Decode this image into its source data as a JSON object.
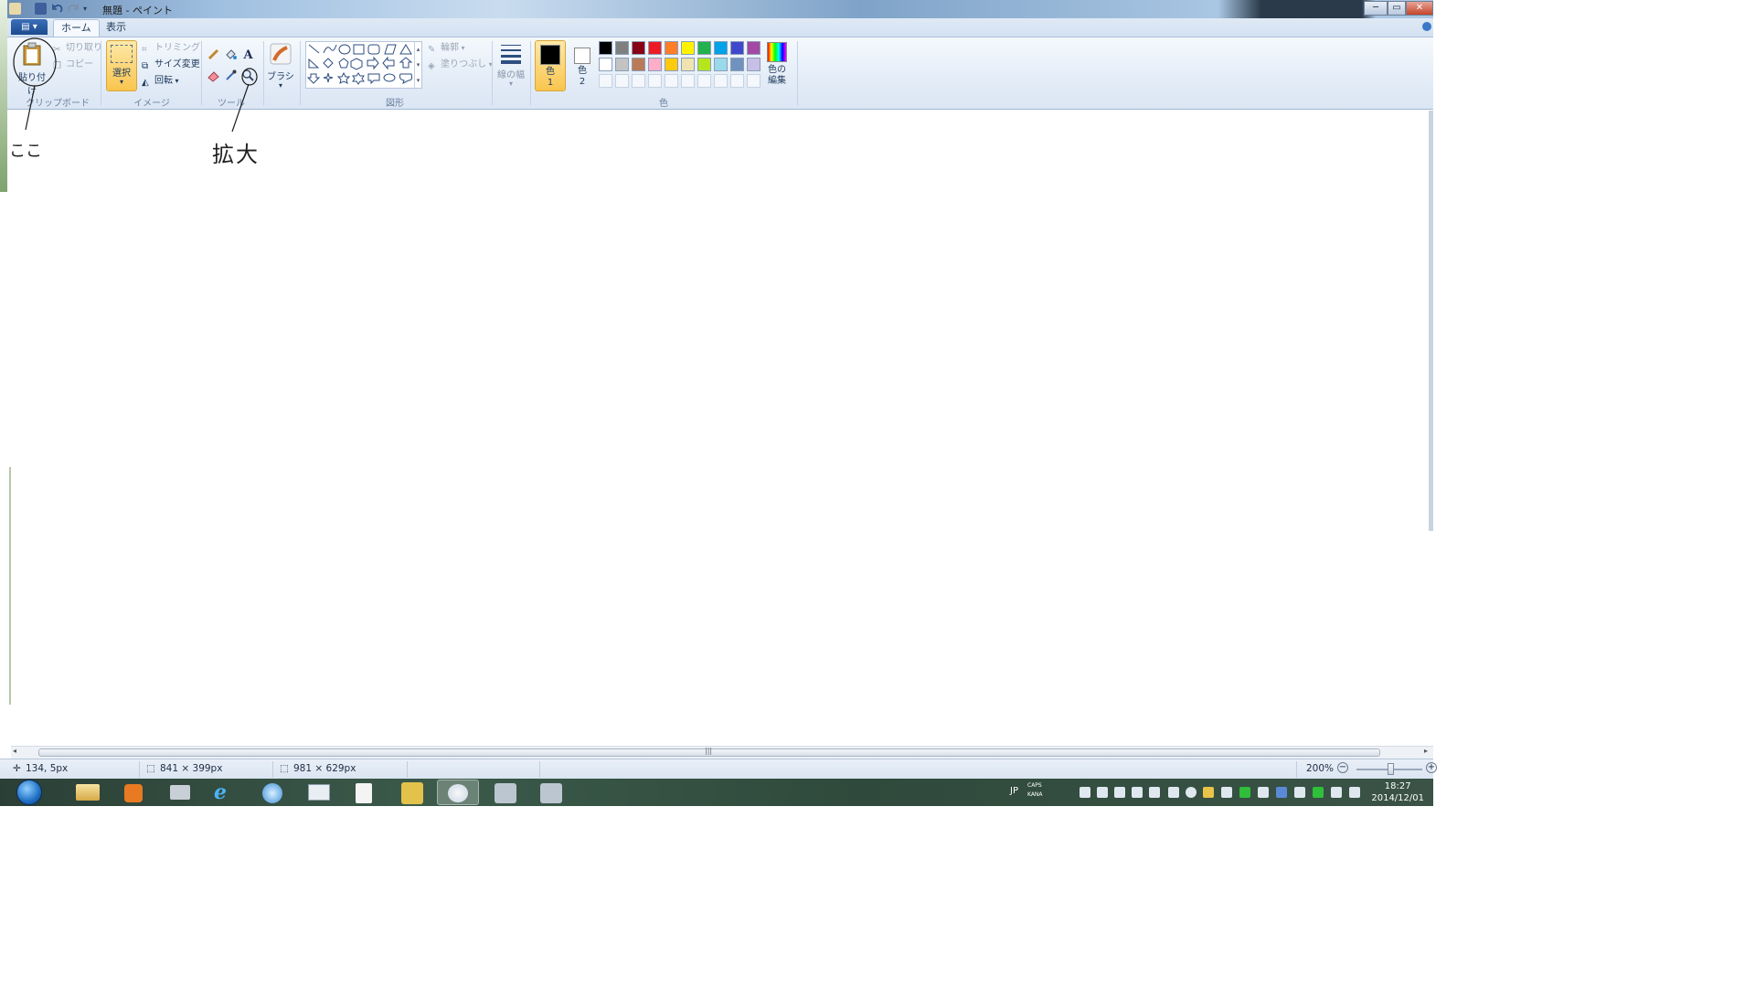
{
  "window": {
    "title": "無題 - ペイント",
    "minimize_glyph": "─",
    "maximize_glyph": "▭",
    "close_glyph": "✕"
  },
  "tabs": {
    "app_menu": "▤ ▾",
    "home": "ホーム",
    "view": "表示"
  },
  "ribbon": {
    "clipboard": {
      "paste": "貼り付け",
      "cut": "切り取り",
      "copy": "コピー",
      "group": "クリップボード"
    },
    "image": {
      "select": "選択",
      "crop": "トリミング",
      "resize": "サイズ変更",
      "rotate": "回転",
      "group": "イメージ"
    },
    "tools": {
      "group": "ツール"
    },
    "brush": {
      "label": "ブラシ"
    },
    "shapes": {
      "outline": "輪郭",
      "fill": "塗りつぶし",
      "group": "図形"
    },
    "size": {
      "label": "線の幅"
    },
    "colors": {
      "color1": "色\n1",
      "color1_a": "色",
      "color1_b": "1",
      "color2_a": "色",
      "color2_b": "2",
      "edit_a": "色の",
      "edit_b": "編集",
      "group": "色",
      "palette_row1": [
        "#000000",
        "#7f7f7f",
        "#880015",
        "#ed1c24",
        "#ff7f27",
        "#fff200",
        "#22b14c",
        "#00a2e8",
        "#3f48cc",
        "#a349a4"
      ],
      "palette_row2": [
        "#ffffff",
        "#c3c3c3",
        "#b97a57",
        "#ffaec9",
        "#ffc90e",
        "#efe4b0",
        "#b5e61d",
        "#99d9ea",
        "#7092be",
        "#c8bfe7"
      ]
    }
  },
  "annotations": {
    "koko": "ここ",
    "kakudai": "拡大"
  },
  "statusbar": {
    "cursor": "134, 5px",
    "selection": "841 × 399px",
    "image_size": "981 × 629px",
    "zoom": "200%"
  },
  "taskbar": {
    "ime": "JP",
    "caps": "CAPS",
    "kana": "KANA",
    "time": "18:27",
    "date": "2014/12/01"
  }
}
